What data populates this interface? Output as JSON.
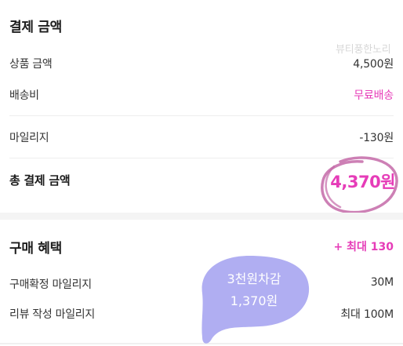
{
  "payment": {
    "title": "결제 금액",
    "rows": [
      {
        "label": "상품 금액",
        "value": "4,500원"
      },
      {
        "label": "배송비",
        "value": "무료배송"
      },
      {
        "label": "마일리지",
        "value": "-130원"
      }
    ],
    "total_label": "총 결제 금액",
    "total_value": "4,370원"
  },
  "benefit": {
    "title": "구매 혜택",
    "max_label": "+ 최대 130",
    "rows": [
      {
        "label": "구매확정 마일리지",
        "value": "30M"
      },
      {
        "label": "리뷰 작성 마일리지",
        "value": "최대 100M"
      }
    ]
  },
  "watermark": "뷰티풍한노리",
  "sticker": {
    "line1": "3천원차감",
    "line2": "1,370원"
  },
  "colors": {
    "accent_pink": "#e63cb8",
    "circle_mark": "#c46aa8",
    "sticker_fill": "#b0aef2"
  }
}
